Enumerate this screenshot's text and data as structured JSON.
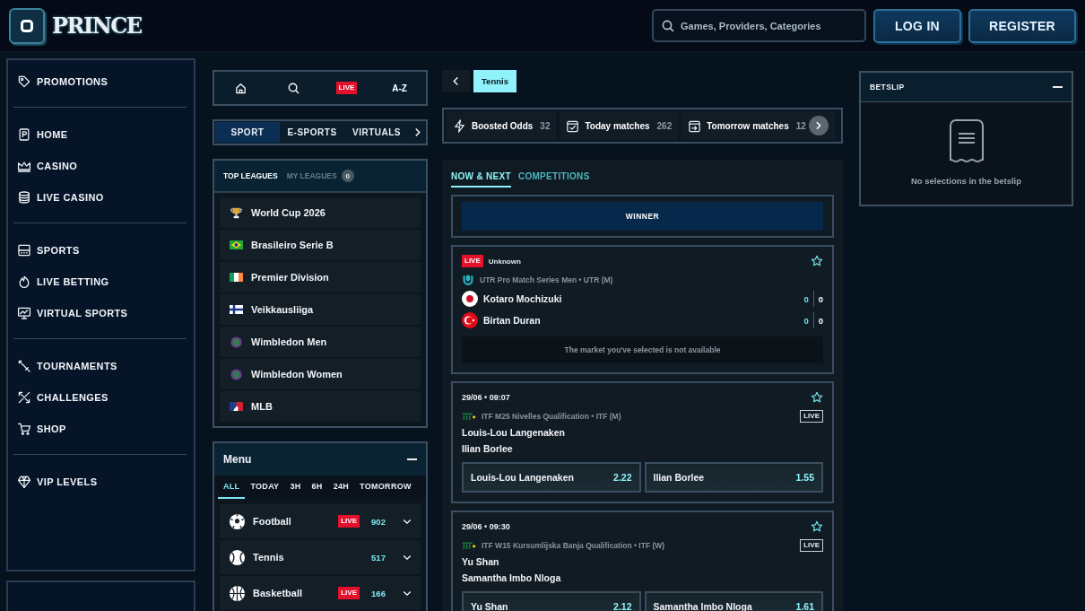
{
  "header": {
    "logo": "PRINCE",
    "search": {
      "placeholder": "Games, Providers, Categories"
    },
    "buttons": [
      {
        "kind": "login",
        "label": "LOG IN"
      },
      {
        "kind": "register",
        "label": "REGISTER"
      }
    ]
  },
  "sidebar": {
    "groups": [
      {
        "items": [
          {
            "label": "PROMOTIONS"
          }
        ]
      },
      {
        "items": [
          {
            "label": "HOME"
          },
          {
            "label": "CASINO"
          },
          {
            "label": "LIVE CASINO"
          }
        ]
      },
      {
        "items": [
          {
            "label": "SPORTS"
          },
          {
            "label": "LIVE BETTING"
          },
          {
            "label": "VIRTUAL SPORTS"
          }
        ]
      },
      {
        "items": [
          {
            "label": "TOURNAMENTS"
          },
          {
            "label": "CHALLENGES"
          },
          {
            "label": "SHOP"
          }
        ]
      },
      {
        "items": [
          {
            "label": "VIP LEVELS"
          }
        ]
      }
    ]
  },
  "quick_nav": {
    "live": "LIVE",
    "az": "A-Z"
  },
  "section_tabs": [
    {
      "label": "SPORT",
      "selected": true
    },
    {
      "label": "E-SPORTS",
      "selected": false
    },
    {
      "label": "VIRTUALS",
      "selected": false
    }
  ],
  "leagues": {
    "tabs": [
      {
        "label": "TOP LEAGUES",
        "selected": true
      },
      {
        "label": "MY LEAGUES",
        "selected": false,
        "count": "0"
      }
    ],
    "items": [
      {
        "name": "World Cup 2026"
      },
      {
        "name": "Brasileiro Serie B"
      },
      {
        "name": "Premier Division"
      },
      {
        "name": "Veikkausliiga"
      },
      {
        "name": "Wimbledon Men"
      },
      {
        "name": "Wimbledon Women"
      },
      {
        "name": "MLB"
      }
    ]
  },
  "sport_menu": {
    "title": "Menu",
    "filters": [
      {
        "label": "ALL",
        "selected": true
      },
      {
        "label": "TODAY",
        "selected": false
      },
      {
        "label": "3H",
        "selected": false
      },
      {
        "label": "6H",
        "selected": false
      },
      {
        "label": "24H",
        "selected": false
      },
      {
        "label": "TOMORROW",
        "selected": false
      }
    ],
    "sports": [
      {
        "name": "Football",
        "badge": "LIVE",
        "count": "902"
      },
      {
        "name": "Tennis",
        "count": "517"
      },
      {
        "name": "Basketball",
        "badge": "LIVE",
        "count": "166"
      }
    ]
  },
  "breadcrumb": {
    "current": "Tennis"
  },
  "quick_filters": [
    {
      "label": "Boosted Odds",
      "count": "32"
    },
    {
      "label": "Today matches",
      "count": "262"
    },
    {
      "label": "Tomorrow matches",
      "count": "12"
    }
  ],
  "main_tabs": [
    {
      "label": "NOW & NEXT",
      "selected": true
    },
    {
      "label": "COMPETITIONS",
      "selected": false
    }
  ],
  "market": {
    "label": "WINNER"
  },
  "events": [
    {
      "kind": "live",
      "badge": "LIVE",
      "status": "Unknown",
      "favorite": false,
      "competition": "UTR Pro Match Series Men • UTR (M)",
      "players": [
        {
          "name": "Kotaro Mochizuki",
          "scores": [
            "0",
            "0"
          ]
        },
        {
          "name": "Birtan Duran",
          "scores": [
            "0",
            "0"
          ]
        }
      ],
      "notice": "The market you've selected is not available"
    },
    {
      "kind": "scheduled",
      "time": "29/06 • 09:07",
      "favorite": false,
      "competition": "ITF M25 Nivelles Qualification • ITF (M)",
      "badge": "LIVE",
      "players": [
        {
          "name": "Louis-Lou Langenaken"
        },
        {
          "name": "Ilian Borlee"
        }
      ],
      "odds": [
        {
          "label": "Louis-Lou Langenaken",
          "price": "2.22"
        },
        {
          "label": "Ilian Borlee",
          "price": "1.55"
        }
      ]
    },
    {
      "kind": "scheduled",
      "time": "29/06 • 09:30",
      "favorite": false,
      "competition": "ITF W15 Kursumlijska Banja Qualification • ITF (W)",
      "badge": "LIVE",
      "players": [
        {
          "name": "Yu Shan"
        },
        {
          "name": "Samantha Imbo Nloga"
        }
      ],
      "odds": [
        {
          "label": "Yu Shan",
          "price": "2.12"
        },
        {
          "label": "Samantha Imbo Nloga",
          "price": "1.61"
        }
      ]
    }
  ],
  "betslip": {
    "title": "BETSLIP",
    "empty_text": "No selections in the betslip"
  }
}
